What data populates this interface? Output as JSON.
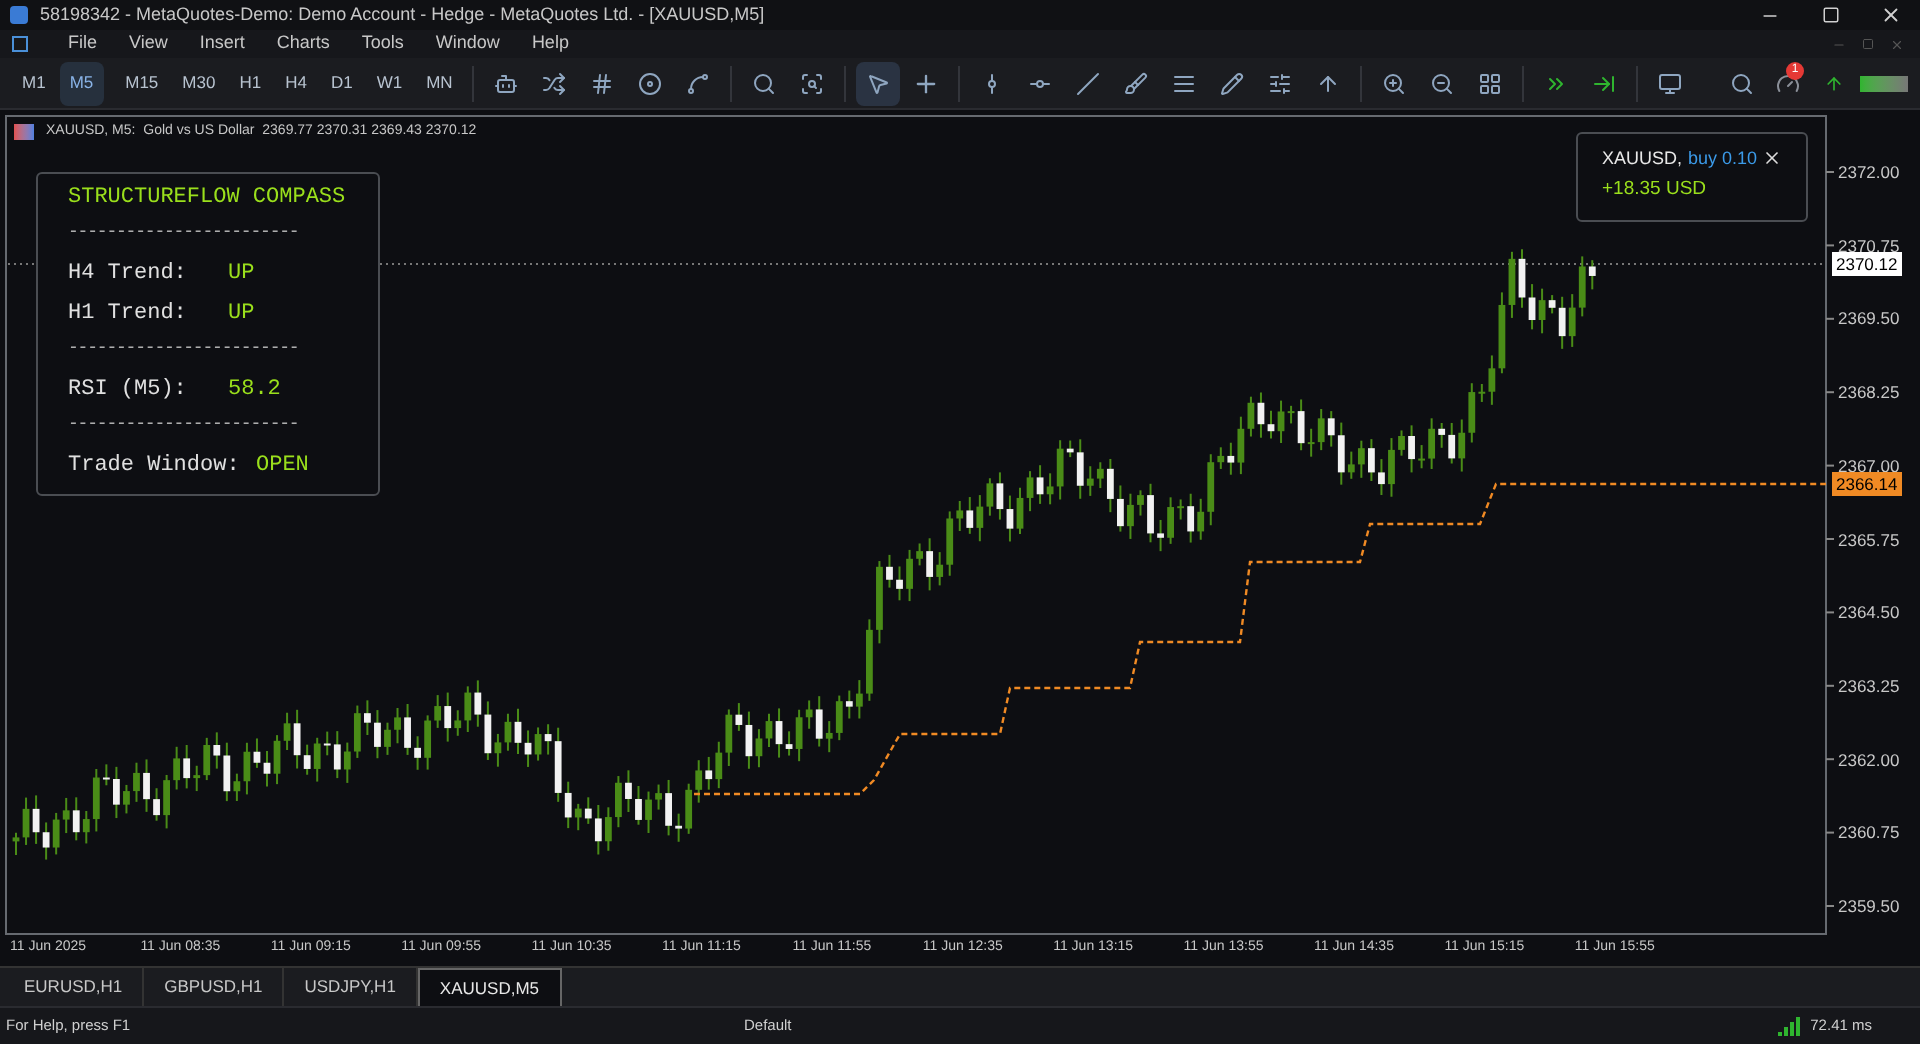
{
  "window": {
    "title": "58198342 - MetaQuotes-Demo: Demo Account - Hedge - MetaQuotes Ltd. - [XAUUSD,M5]"
  },
  "menu": [
    "File",
    "View",
    "Insert",
    "Charts",
    "Tools",
    "Window",
    "Help"
  ],
  "timeframes": [
    {
      "label": "M1",
      "selected": false
    },
    {
      "label": "M5",
      "selected": true
    },
    {
      "label": "M15",
      "selected": false
    },
    {
      "label": "M30",
      "selected": false
    },
    {
      "label": "H1",
      "selected": false
    },
    {
      "label": "H4",
      "selected": false
    },
    {
      "label": "D1",
      "selected": false
    },
    {
      "label": "W1",
      "selected": false
    },
    {
      "label": "MN",
      "selected": false
    }
  ],
  "notifications": {
    "count": "1"
  },
  "chart": {
    "header": "XAUUSD, M5:  Gold vs US Dollar  2369.77 2370.31 2369.43 2370.12",
    "panel": {
      "title": "STRUCTUREFLOW COMPASS",
      "rows": [
        {
          "kind": "divider",
          "text": "------------------------"
        },
        {
          "kind": "value",
          "label": "H4 Trend:",
          "value": "UP"
        },
        {
          "kind": "value",
          "label": "H1 Trend:",
          "value": "UP"
        },
        {
          "kind": "divider",
          "text": "------------------------"
        },
        {
          "kind": "value",
          "label": "RSI (M5):",
          "value": "58.2"
        },
        {
          "kind": "divider",
          "text": "------------------------"
        },
        {
          "kind": "value",
          "label": "Trade Window:",
          "value": "OPEN"
        }
      ]
    },
    "position": {
      "symbol": "XAUUSD,",
      "side": "buy 0.10",
      "profit": "+18.35 USD"
    },
    "price_axis": [
      "2372.00",
      "2370.75",
      "2369.50",
      "2368.25",
      "2367.00",
      "2365.75",
      "2364.50",
      "2363.25",
      "2362.00",
      "2360.75",
      "2359.50"
    ],
    "current_price": "2370.12",
    "stop_level": "2366.14",
    "time_axis": [
      "11 Jun 2025",
      "11 Jun 08:35",
      "11 Jun 09:15",
      "11 Jun 09:55",
      "11 Jun 10:35",
      "11 Jun 11:15",
      "11 Jun 11:55",
      "11 Jun 12:35",
      "11 Jun 13:15",
      "11 Jun 13:55",
      "11 Jun 14:35",
      "11 Jun 15:15",
      "11 Jun 15:55"
    ]
  },
  "chart_tabs": [
    {
      "label": "EURUSD,H1",
      "selected": false
    },
    {
      "label": "GBPUSD,H1",
      "selected": false
    },
    {
      "label": "USDJPY,H1",
      "selected": false
    },
    {
      "label": "XAUUSD,M5",
      "selected": true
    }
  ],
  "status_bar": {
    "help": "For Help, press F1",
    "profile": "Default",
    "ping": "72.41 ms"
  }
}
